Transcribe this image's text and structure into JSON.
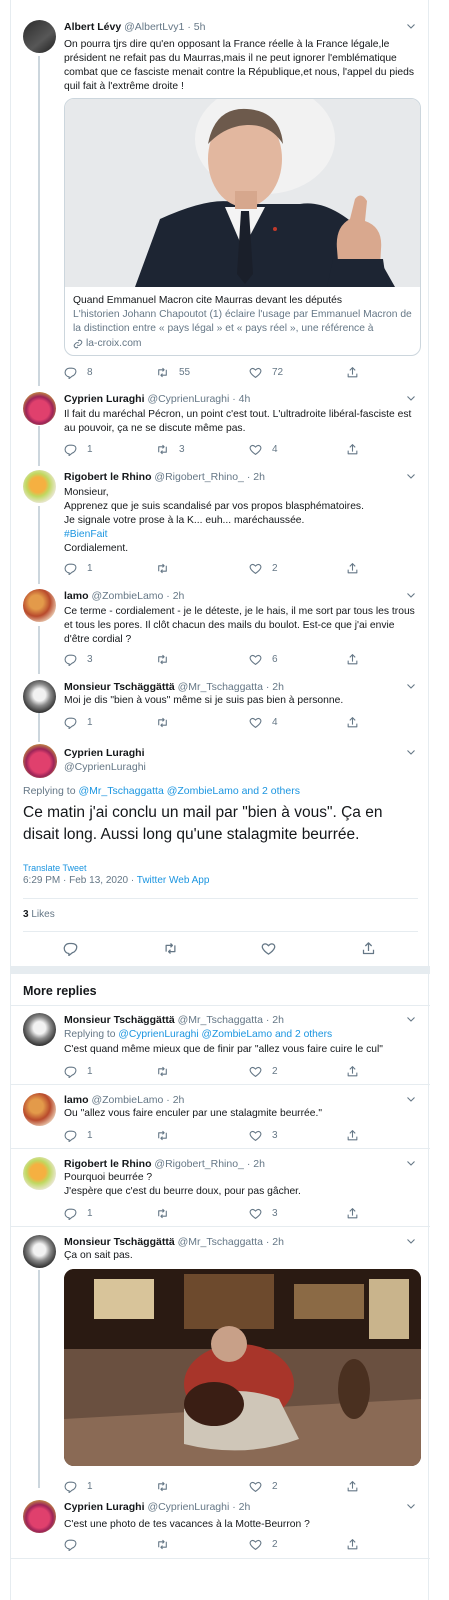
{
  "tweets": [
    {
      "name": "Albert Lévy",
      "handle": "@AlbertLvy1",
      "time": "5h",
      "text": "On pourra tjrs dire qu'en opposant la France réelle à la France légale,le président ne refait pas du Maurras,mais il ne peut ignorer l'emblématique combat que ce fasciste menait contre la République,et nous, l'appel du pieds quil fait à l'extrême droite !",
      "card": {
        "title": "Quand Emmanuel Macron cite Maurras devant les députés",
        "description": "L'historien Johann Chapoutot (1) éclaire l'usage par Emmanuel Macron de la distinction entre « pays légal » et « pays réel », une référence à Charle...",
        "domain": "la-croix.com"
      },
      "replies": "8",
      "retweets": "55",
      "likes": "72"
    },
    {
      "name": "Cyprien Luraghi",
      "handle": "@CyprienLuraghi",
      "time": "4h",
      "text": "Il fait du maréchal Pécron, un point c'est tout. L'ultradroite libéral-fasciste est au pouvoir, ça ne se discute même pas.",
      "replies": "1",
      "retweets": "3",
      "likes": "4"
    },
    {
      "name": "Rigobert le Rhino",
      "handle": "@Rigobert_Rhino_",
      "time": "2h",
      "text_lines": [
        "Monsieur,",
        "Apprenez que je suis scandalisé par vos propos blasphématoires.",
        "Je signale votre prose à la K... euh... maréchaussée."
      ],
      "hashtag": "#BienFait",
      "closing": "Cordialement.",
      "replies": "1",
      "retweets": "",
      "likes": "2"
    },
    {
      "name": "lamo",
      "handle": "@ZombieLamo",
      "time": "2h",
      "text": "Ce terme - cordialement - je le déteste, je le hais, il me sort par tous les trous et tous les pores. Il clôt chacun des mails du boulot. Est-ce que j'ai envie d'être cordial ?",
      "replies": "3",
      "retweets": "",
      "likes": "6"
    },
    {
      "name": "Monsieur Tschäggättä",
      "handle": "@Mr_Tschaggatta",
      "time": "2h",
      "text": "Moi je dis \"bien à vous\" même si je suis pas bien à personne.",
      "replies": "1",
      "retweets": "",
      "likes": "4"
    }
  ],
  "main_tweet": {
    "name": "Cyprien Luraghi",
    "handle": "@CyprienLuraghi",
    "replying_label": "Replying to",
    "replying_to": "@Mr_Tschaggatta @ZombieLamo and 2 others",
    "text": "Ce matin j'ai conclu un mail par \"bien à vous\". Ça en disait long. Aussi long qu'une stalagmite beurrée.",
    "translate": "Translate Tweet",
    "timestamp": "6:29 PM · Feb 13, 2020 · ",
    "source": "Twitter Web App",
    "likes_count": "3",
    "likes_label": "Likes"
  },
  "more_replies_title": "More replies",
  "replies": [
    {
      "name": "Monsieur Tschäggättä",
      "handle": "@Mr_Tschaggatta",
      "time": "2h",
      "replying_label": "Replying to",
      "replying_to": "@CyprienLuraghi @ZombieLamo and 2 others",
      "text": "C'est quand même mieux que de finir par \"allez vous faire cuire le cul\"",
      "replies": "1",
      "retweets": "",
      "likes": "2"
    },
    {
      "name": "lamo",
      "handle": "@ZombieLamo",
      "time": "2h",
      "text": "Ou \"allez vous faire enculer par une stalagmite beurrée.\"",
      "replies": "1",
      "retweets": "",
      "likes": "3"
    },
    {
      "name": "Rigobert le Rhino",
      "handle": "@Rigobert_Rhino_",
      "time": "2h",
      "text_lines": [
        "Pourquoi beurrée ?",
        "J'espère que c'est du beurre doux, pour pas gâcher."
      ],
      "replies": "1",
      "retweets": "",
      "likes": "3"
    },
    {
      "name": "Monsieur Tschäggättä",
      "handle": "@Mr_Tschaggatta",
      "time": "2h",
      "text": "Ça on sait pas.",
      "replies": "1",
      "retweets": "",
      "likes": "2"
    },
    {
      "name": "Cyprien Luraghi",
      "handle": "@CyprienLuraghi",
      "time": "2h",
      "text": "C'est une photo de tes vacances à la Motte-Beurron ?",
      "replies": "",
      "retweets": "",
      "likes": "2"
    }
  ],
  "icons": {
    "reply": "reply-icon",
    "retweet": "retweet-icon",
    "like": "heart-icon",
    "share": "share-icon",
    "caret": "chevron-down-icon",
    "link": "link-icon"
  },
  "colors": {
    "accent": "#1b95e0",
    "text": "#14171a",
    "muted": "#657786",
    "border": "#e6ecf0"
  }
}
